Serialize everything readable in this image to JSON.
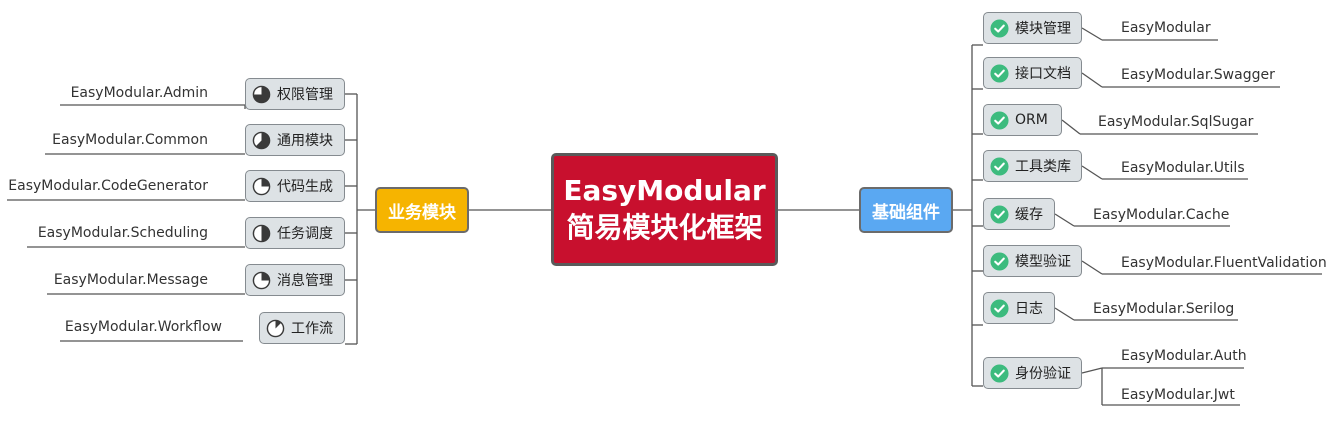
{
  "central": {
    "line1": "EasyModular",
    "line2": "简易模块化框架"
  },
  "left_branch": {
    "label": "业务模块",
    "items": [
      {
        "label": "权限管理",
        "module": "EasyModular.Admin",
        "pie": 0.75
      },
      {
        "label": "通用模块",
        "module": "EasyModular.Common",
        "pie": 0.625
      },
      {
        "label": "代码生成",
        "module": "EasyModular.CodeGenerator",
        "pie": 0.25
      },
      {
        "label": "任务调度",
        "module": "EasyModular.Scheduling",
        "pie": 0.5
      },
      {
        "label": "消息管理",
        "module": "EasyModular.Message",
        "pie": 0.25
      },
      {
        "label": "工作流",
        "module": "EasyModular.Workflow",
        "pie": 0.125
      }
    ]
  },
  "right_branch": {
    "label": "基础组件",
    "items": [
      {
        "label": "模块管理",
        "modules": [
          "EasyModular"
        ]
      },
      {
        "label": "接口文档",
        "modules": [
          "EasyModular.Swagger"
        ]
      },
      {
        "label": "ORM",
        "modules": [
          "EasyModular.SqlSugar"
        ]
      },
      {
        "label": "工具类库",
        "modules": [
          "EasyModular.Utils"
        ]
      },
      {
        "label": "缓存",
        "modules": [
          "EasyModular.Cache"
        ]
      },
      {
        "label": "模型验证",
        "modules": [
          "EasyModular.FluentValidation"
        ]
      },
      {
        "label": "日志",
        "modules": [
          "EasyModular.Serilog"
        ]
      },
      {
        "label": "身份验证",
        "modules": [
          "EasyModular.Auth",
          "EasyModular.Jwt"
        ]
      }
    ]
  },
  "colors": {
    "central": "#c8102e",
    "business": "#f6b400",
    "foundation": "#5aa8f2",
    "check": "#3dbb7e",
    "pie": "#3a3a3a"
  }
}
